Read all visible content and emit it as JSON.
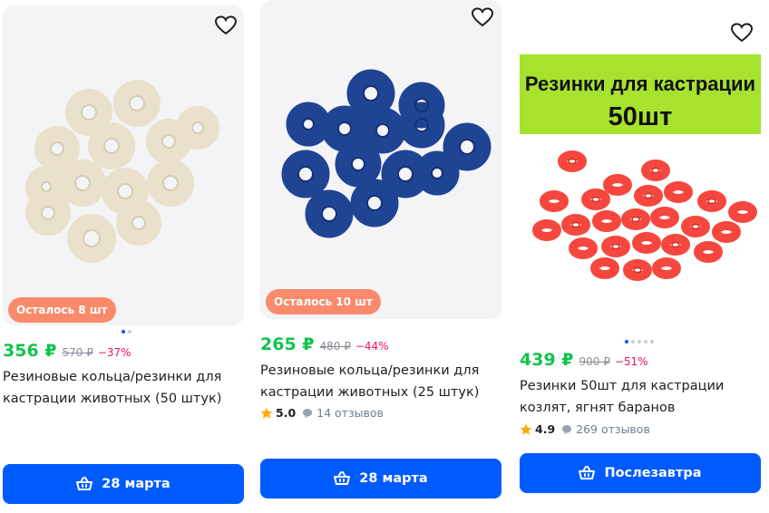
{
  "products": [
    {
      "stock_badge": "Осталось 8 шт",
      "price": "356 ₽",
      "old_price": "570 ₽",
      "discount": "−37%",
      "title": "Резиновые кольца/резинки для кастрации животных (50 штук)",
      "button_label": "28 марта",
      "image": {
        "ring_color": "#ede6d1",
        "gallery_dots": 2,
        "active_dot": 1
      }
    },
    {
      "stock_badge": "Осталось 10 шт",
      "price": "265 ₽",
      "old_price": "480 ₽",
      "discount": "−44%",
      "title": "Резиновые кольца/резинки для кастрации животных (25 штук)",
      "rating": "5.0",
      "reviews": "14 отзывов",
      "button_label": "28 марта",
      "image": {
        "ring_color": "#1f4494"
      }
    },
    {
      "price": "439 ₽",
      "old_price": "900 ₽",
      "discount": "−51%",
      "title": "Резинки 50шт для кастрации козлят, ягнят баранов",
      "rating": "4.9",
      "reviews": "269 отзывов",
      "button_label": "Послезавтра",
      "image": {
        "banner_line1": "Резинки для кастрации",
        "banner_line2": "50шт",
        "banner_color": "#a6e22e",
        "ring_color": "#f5473e",
        "gallery_dots": 5,
        "active_dot": 1
      }
    }
  ],
  "icons": {
    "favorite": "heart-icon",
    "basket": "basket-icon",
    "rating": "star-icon",
    "reviews": "chat-bubble-icon"
  },
  "colors": {
    "price": "#10c44c",
    "discount": "#f91155",
    "button": "#005bff",
    "badge": "#f98b6c"
  }
}
